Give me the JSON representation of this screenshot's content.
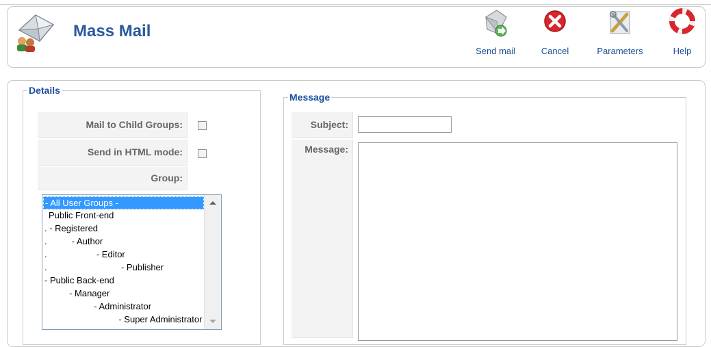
{
  "header": {
    "title": "Mass Mail",
    "icons": {
      "title_icon": "mass-mail-icon"
    }
  },
  "toolbar": {
    "buttons": [
      {
        "label": "Send mail",
        "icon": "send-mail-icon"
      },
      {
        "label": "Cancel",
        "icon": "cancel-icon"
      },
      {
        "label": "Parameters",
        "icon": "parameters-icon"
      },
      {
        "label": "Help",
        "icon": "help-icon"
      }
    ]
  },
  "details": {
    "legend": "Details",
    "mail_to_child_groups_label": "Mail to Child Groups:",
    "send_in_html_mode_label": "Send in HTML mode:",
    "group_label": "Group:",
    "group_options": [
      "- All User Groups -",
      "Public Front-end",
      ". - Registered",
      ".          - Author",
      ".                    - Editor",
      ".                              - Publisher",
      "- Public Back-end",
      "          - Manager",
      "                    - Administrator",
      "                              - Super Administrator"
    ],
    "selected_group": "- All User Groups -"
  },
  "message": {
    "legend": "Message",
    "subject_label": "Subject:",
    "subject_value": "",
    "message_label": "Message:",
    "message_value": ""
  },
  "colors": {
    "title": "#2a5a9c",
    "legend": "#1b4fa0",
    "toolbar_label": "#1c4f97",
    "selection": "#3399ff"
  }
}
